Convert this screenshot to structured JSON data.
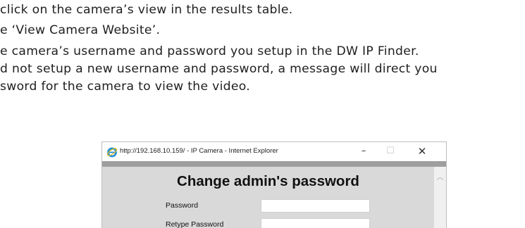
{
  "document": {
    "lines": [
      "click on the camera’s view in the results table.",
      "e ‘View Camera Website’.",
      "e camera’s username and password you setup in the DW IP Finder.",
      "d not setup a new username and password, a message will direct you",
      "sword for the camera to view the video."
    ]
  },
  "browser": {
    "title": "http://192.168.10.159/ - IP Camera - Internet Explorer",
    "icon": "internet-explorer-icon",
    "controls": {
      "minimize": "–",
      "maximize": "☐",
      "close": "✕"
    }
  },
  "page": {
    "heading": "Change admin's password",
    "fields": [
      {
        "label": "Password",
        "value": ""
      },
      {
        "label": "Retype Password",
        "value": ""
      }
    ]
  },
  "colors": {
    "content_background": "#d9d9d9",
    "strip": "#9e9e9e",
    "ie_blue": "#1e8fd6",
    "ie_ring": "#f5b800"
  }
}
